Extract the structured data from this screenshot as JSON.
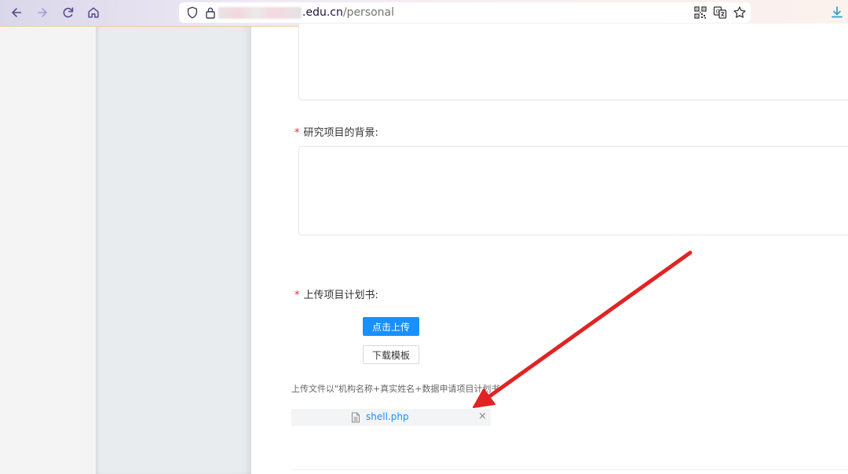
{
  "browser": {
    "url_domain": ".edu.cn",
    "url_path": "/personal",
    "icons": [
      "back-icon",
      "forward-icon",
      "reload-icon",
      "home-icon",
      "shield-icon",
      "lock-icon",
      "qr-code-icon",
      "translate-icon",
      "bookmark-star-icon",
      "download-icon"
    ]
  },
  "form": {
    "background_label": "研究项目的背景:",
    "upload_label": "上传项目计划书:",
    "required_mark": "*",
    "upload_button": "点击上传",
    "download_template_button": "下载模板",
    "hint": "上传文件以\"机构名称+真实姓名+数据申请项目计划书",
    "file_name": "shell.php",
    "file_remove": "×"
  },
  "colors": {
    "primary": "#1890ff",
    "required": "#f5222d",
    "arrow": "#e02424"
  }
}
